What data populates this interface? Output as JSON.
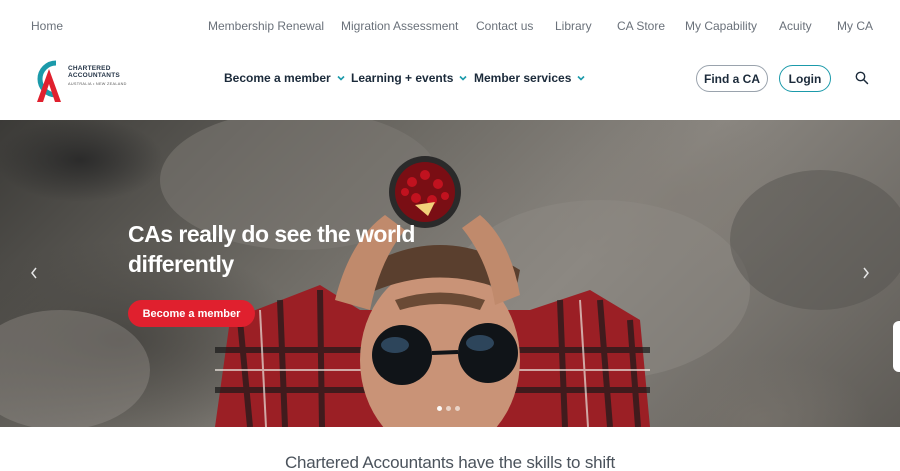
{
  "utility_nav": {
    "home": "Home",
    "links": [
      "Membership Renewal",
      "Migration Assessment",
      "Contact us",
      "Library",
      "CA Store",
      "My Capability",
      "Acuity",
      "My CA"
    ]
  },
  "logo": {
    "line1": "CHARTERED",
    "line2": "ACCOUNTANTS",
    "sub": "AUSTRALIA • NEW ZEALAND"
  },
  "main_nav": {
    "items": [
      "Become a member",
      "Learning + events",
      "Member services"
    ]
  },
  "header_actions": {
    "find_ca": "Find a CA",
    "login": "Login"
  },
  "hero": {
    "heading": "CAs really do see the world differently",
    "cta": "Become a member",
    "slide_count": 3,
    "active_slide": 1
  },
  "tagline": "Chartered Accountants have the skills to shift",
  "colors": {
    "brand_teal": "#1b9aaa",
    "brand_red": "#e0202e",
    "text_dark": "#1b2a3a"
  }
}
